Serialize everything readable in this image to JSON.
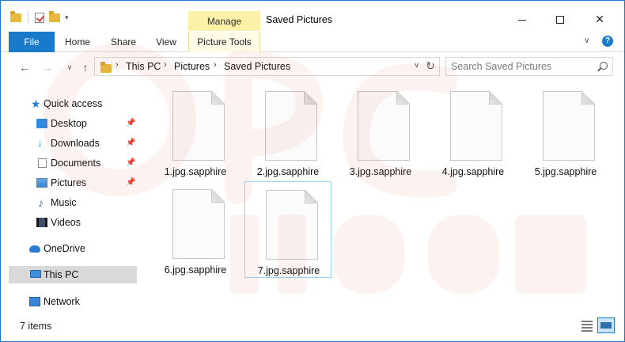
{
  "window": {
    "title": "Saved Pictures",
    "context_tab_group": "Manage"
  },
  "ribbon": {
    "tabs": [
      "File",
      "Home",
      "Share",
      "View",
      "Picture Tools"
    ],
    "help": "?"
  },
  "address": {
    "crumbs": [
      "This PC",
      "Pictures",
      "Saved Pictures"
    ],
    "search_placeholder": "Search Saved Pictures"
  },
  "nav_pane": {
    "quick_access": "Quick access",
    "quick_items": [
      {
        "label": "Desktop",
        "icon": "desktop-icon",
        "pinned": true
      },
      {
        "label": "Downloads",
        "icon": "downloads-icon",
        "pinned": true
      },
      {
        "label": "Documents",
        "icon": "documents-icon",
        "pinned": true
      },
      {
        "label": "Pictures",
        "icon": "pictures-icon",
        "pinned": true
      },
      {
        "label": "Music",
        "icon": "music-icon",
        "pinned": false
      },
      {
        "label": "Videos",
        "icon": "videos-icon",
        "pinned": false
      }
    ],
    "onedrive": "OneDrive",
    "this_pc": "This PC",
    "network": "Network"
  },
  "files": [
    "1.jpg.sapphire",
    "2.jpg.sapphire",
    "3.jpg.sapphire",
    "4.jpg.sapphire",
    "5.jpg.sapphire",
    "6.jpg.sapphire",
    "7.jpg.sapphire"
  ],
  "status": {
    "item_count": "7 items"
  },
  "colors": {
    "accent": "#1979ca",
    "manage_tab": "#fdf0a8",
    "watermark": "#d8503c"
  }
}
